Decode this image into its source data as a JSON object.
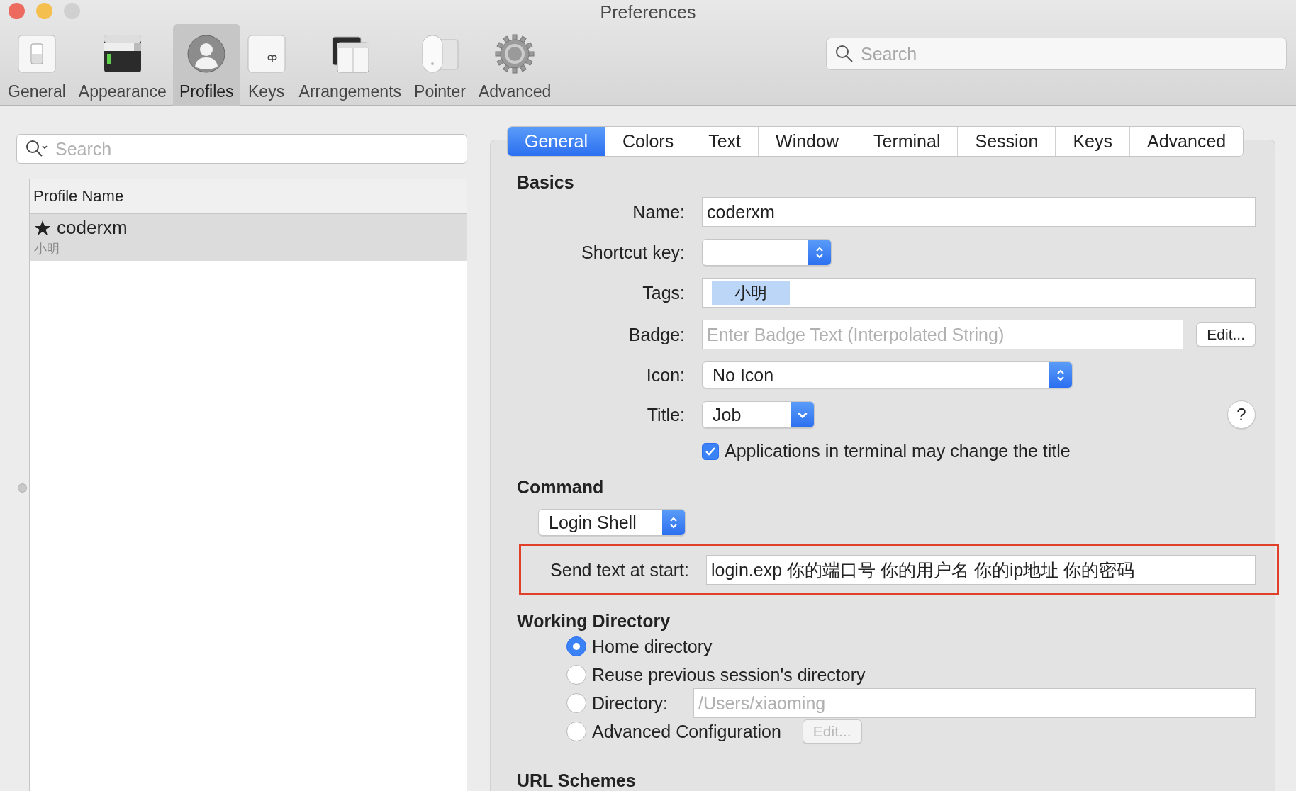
{
  "window": {
    "title": "Preferences"
  },
  "toolbar": {
    "items": [
      {
        "label": "General",
        "selected": false
      },
      {
        "label": "Appearance",
        "selected": false
      },
      {
        "label": "Profiles",
        "selected": true
      },
      {
        "label": "Keys",
        "selected": false
      },
      {
        "label": "Arrangements",
        "selected": false
      },
      {
        "label": "Pointer",
        "selected": false
      },
      {
        "label": "Advanced",
        "selected": false
      }
    ],
    "search": {
      "placeholder": "Search"
    }
  },
  "profiles": {
    "search": {
      "placeholder": "Search"
    },
    "column": "Profile Name",
    "rows": [
      {
        "name": "coderxm",
        "tag": "小明",
        "default": true,
        "selected": true
      }
    ]
  },
  "tabs": [
    {
      "label": "General",
      "selected": true
    },
    {
      "label": "Colors",
      "selected": false
    },
    {
      "label": "Text",
      "selected": false
    },
    {
      "label": "Window",
      "selected": false
    },
    {
      "label": "Terminal",
      "selected": false
    },
    {
      "label": "Session",
      "selected": false
    },
    {
      "label": "Keys",
      "selected": false
    },
    {
      "label": "Advanced",
      "selected": false
    }
  ],
  "basics": {
    "title": "Basics",
    "rows": [
      {
        "kind": "text",
        "label": "Name:",
        "value": "coderxm"
      },
      {
        "kind": "shortcut",
        "label": "Shortcut key:"
      },
      {
        "kind": "tags",
        "label": "Tags:",
        "tags": [
          "小明"
        ]
      },
      {
        "kind": "badge",
        "label": "Badge:",
        "placeholder": "Enter Badge Text (Interpolated String)",
        "button": "Edit..."
      },
      {
        "kind": "popup",
        "label": "Icon:",
        "value": "No Icon"
      },
      {
        "kind": "pulldown",
        "label": "Title:",
        "value": "Job",
        "help": "?"
      },
      {
        "kind": "checkbox",
        "label": "Applications in terminal may change the title",
        "checked": true
      }
    ]
  },
  "command": {
    "title": "Command",
    "popup": "Login Shell",
    "send_text": {
      "label": "Send text at start:",
      "value": "login.exp 你的端口号 你的用户名 你的ip地址 你的密码",
      "highlighted": true
    }
  },
  "working_directory": {
    "title": "Working Directory",
    "options": [
      {
        "label": "Home directory",
        "selected": true
      },
      {
        "label": "Reuse previous session's directory",
        "selected": false
      },
      {
        "label": "Directory:",
        "selected": false,
        "placeholder": "/Users/xiaoming"
      },
      {
        "label": "Advanced Configuration",
        "selected": false,
        "button": "Edit...",
        "button_disabled": true
      }
    ]
  },
  "url_schemes": {
    "title": "URL Schemes"
  }
}
